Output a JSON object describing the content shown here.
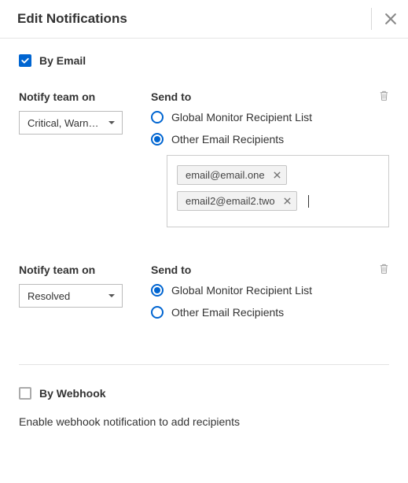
{
  "header": {
    "title": "Edit Notifications"
  },
  "byEmail": {
    "label": "By Email",
    "checked": true
  },
  "block1": {
    "notifyLabel": "Notify team on",
    "selectValue": "Critical, Warn…",
    "sendToLabel": "Send to",
    "radioA": "Global Monitor Recipient List",
    "radioB": "Other Email Recipients",
    "selectedRadio": "B",
    "chips": [
      "email@email.one",
      "email2@email2.two"
    ]
  },
  "block2": {
    "notifyLabel": "Notify team on",
    "selectValue": "Resolved",
    "sendToLabel": "Send to",
    "radioA": "Global Monitor Recipient List",
    "radioB": "Other Email Recipients",
    "selectedRadio": "A"
  },
  "byWebhook": {
    "label": "By Webhook",
    "checked": false,
    "hint": "Enable webhook notification to add recipients"
  }
}
